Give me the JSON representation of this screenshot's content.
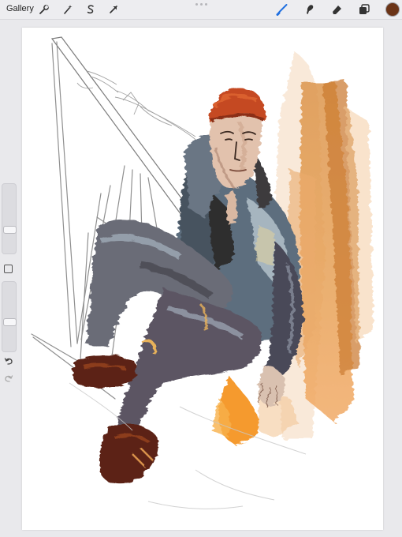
{
  "toolbar": {
    "gallery_label": "Gallery",
    "actions_icon": "wrench-icon",
    "adjustments_icon": "magic-wand-icon",
    "selection_icon": "selection-s-icon",
    "transform_icon": "arrow-cursor-icon",
    "brush_icon": "brush-icon",
    "smudge_icon": "smudge-finger-icon",
    "eraser_icon": "eraser-icon",
    "layers_icon": "layers-icon",
    "active_tool": "brush",
    "active_color": "#6b3417",
    "accent_color": "#1f6fe0"
  },
  "sidebar": {
    "brush_size_level": 0.3,
    "brush_opacity_level": 0.4,
    "modify_icon": "square-icon",
    "undo_icon": "undo-icon",
    "redo_icon": "redo-icon"
  },
  "canvas": {
    "background": "#ffffff",
    "content": "painting"
  }
}
